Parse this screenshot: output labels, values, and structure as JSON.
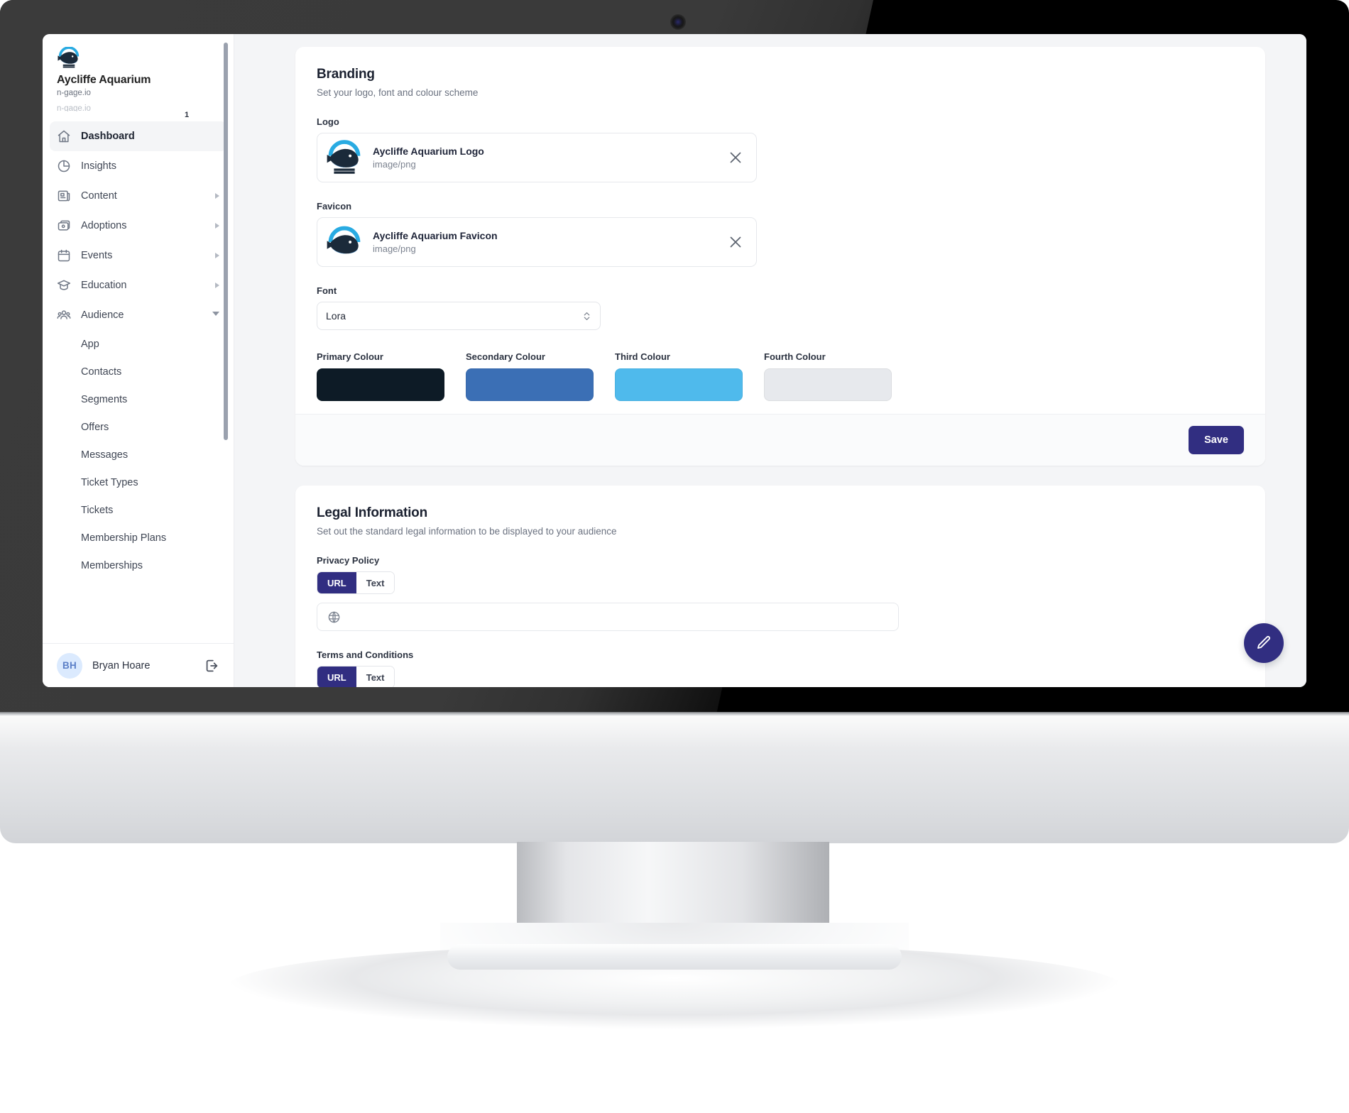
{
  "org": {
    "name": "Aycliffe Aquarium",
    "domain": "n-gage.io",
    "domain_ghost": "n-gage.io",
    "badge": "1"
  },
  "sidebar": {
    "items": [
      {
        "label": "Dashboard",
        "icon": "home-icon",
        "active": true,
        "caret": "none"
      },
      {
        "label": "Insights",
        "icon": "pie-chart-icon",
        "active": false,
        "caret": "none"
      },
      {
        "label": "Content",
        "icon": "news-icon",
        "active": false,
        "caret": "right"
      },
      {
        "label": "Adoptions",
        "icon": "card-icon",
        "active": false,
        "caret": "right"
      },
      {
        "label": "Events",
        "icon": "calendar-icon",
        "active": false,
        "caret": "right"
      },
      {
        "label": "Education",
        "icon": "graduation-cap-icon",
        "active": false,
        "caret": "right"
      },
      {
        "label": "Audience",
        "icon": "users-icon",
        "active": false,
        "caret": "down"
      }
    ],
    "subitems": [
      {
        "label": "App"
      },
      {
        "label": "Contacts"
      },
      {
        "label": "Segments"
      },
      {
        "label": "Offers"
      },
      {
        "label": "Messages"
      },
      {
        "label": "Ticket Types"
      },
      {
        "label": "Tickets"
      },
      {
        "label": "Membership Plans"
      },
      {
        "label": "Memberships"
      }
    ],
    "footer": {
      "avatar_initials": "BH",
      "user_name": "Bryan Hoare",
      "logout_icon": "logout-icon"
    }
  },
  "branding": {
    "title": "Branding",
    "subtitle": "Set your logo, font and colour scheme",
    "logo_label": "Logo",
    "logo_file": {
      "name": "Aycliffe Aquarium Logo",
      "type": "image/png"
    },
    "favicon_label": "Favicon",
    "favicon_file": {
      "name": "Aycliffe Aquarium Favicon",
      "type": "image/png"
    },
    "font_label": "Font",
    "font_value": "Lora",
    "colours": [
      {
        "label": "Primary Colour",
        "value": "#0d1b26"
      },
      {
        "label": "Secondary Colour",
        "value": "#3b6fb5"
      },
      {
        "label": "Third Colour",
        "value": "#4fbaec"
      },
      {
        "label": "Fourth Colour",
        "value": "#e7e9ed"
      }
    ],
    "save_label": "Save"
  },
  "legal": {
    "title": "Legal Information",
    "subtitle": "Set out the standard legal information to be displayed to your audience",
    "privacy_label": "Privacy Policy",
    "toggle": {
      "url": "URL",
      "text": "Text",
      "active": "URL"
    },
    "url_value": "",
    "url_placeholder": "",
    "terms_label": "Terms and Conditions"
  },
  "fab": {
    "icon": "pencil-icon"
  },
  "theme": {
    "accent": "#312e81",
    "surface": "#ffffff",
    "canvas": "#f4f5f7"
  }
}
